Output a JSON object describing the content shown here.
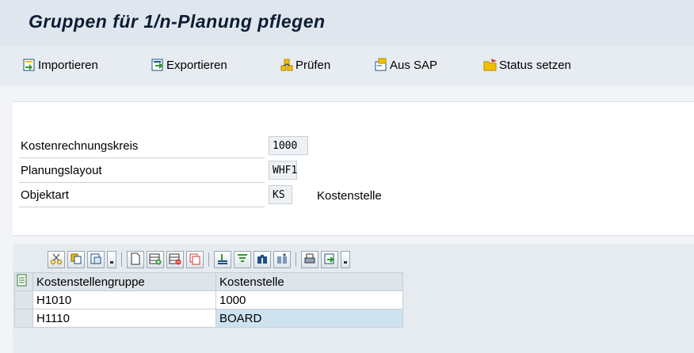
{
  "title": "Gruppen für 1/n-Planung pflegen",
  "toolbar": {
    "import_label": "Importieren",
    "export_label": "Exportieren",
    "check_label": "Prüfen",
    "from_sap_label": "Aus SAP",
    "set_status_label": "Status setzen"
  },
  "form": {
    "fields": [
      {
        "label": "Kostenrechnungskreis",
        "value": "1000"
      },
      {
        "label": "Planungslayout",
        "value": "WHF1"
      },
      {
        "label": "Objektart",
        "value": "KS",
        "description": "Kostenstelle"
      }
    ]
  },
  "grid": {
    "columns": [
      "Kostenstellengruppe",
      "Kostenstelle"
    ],
    "rows": [
      [
        "H1010",
        "1000"
      ],
      [
        "H1110",
        "BOARD"
      ]
    ]
  },
  "colors": {
    "accent": "#0c1c33",
    "selected_cell": "#cde3ef",
    "header_bg": "#dde4ea"
  }
}
